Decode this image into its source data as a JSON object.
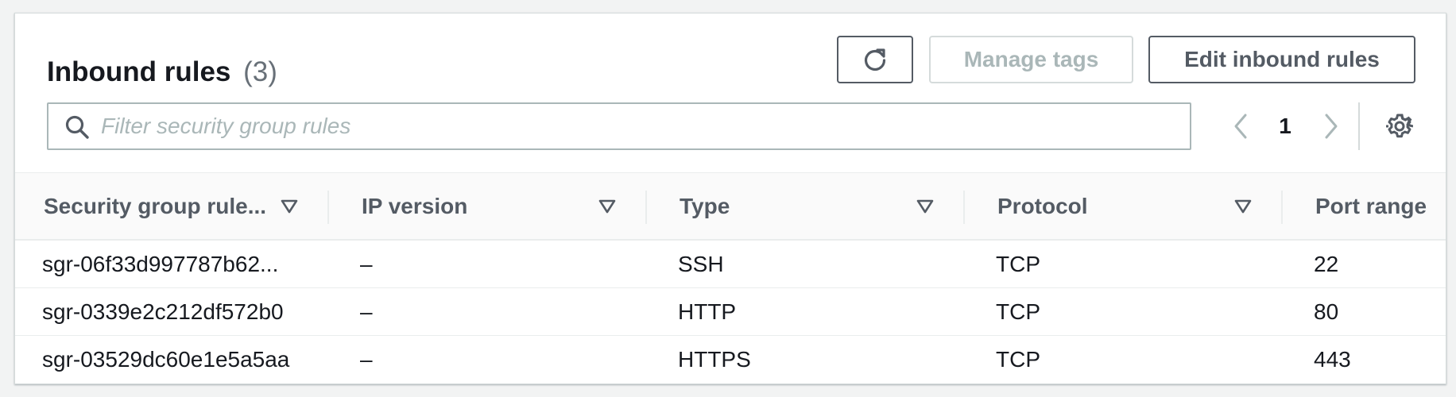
{
  "header": {
    "title": "Inbound rules",
    "count": "(3)",
    "manage_tags_label": "Manage tags",
    "edit_label": "Edit inbound rules"
  },
  "filter": {
    "placeholder": "Filter security group rules",
    "value": ""
  },
  "pagination": {
    "current_page": "1"
  },
  "table": {
    "columns": [
      "Security group rule...",
      "IP version",
      "Type",
      "Protocol",
      "Port range"
    ],
    "rows": [
      [
        "sgr-06f33d997787b62...",
        "–",
        "SSH",
        "TCP",
        "22"
      ],
      [
        "sgr-0339e2c212df572b0",
        "–",
        "HTTP",
        "TCP",
        "80"
      ],
      [
        "sgr-03529dc60e1e5a5aa",
        "–",
        "HTTPS",
        "TCP",
        "443"
      ]
    ]
  },
  "icons": {
    "refresh": "refresh-icon",
    "search": "search-icon",
    "prev": "chevron-left-icon",
    "next": "chevron-right-icon",
    "settings": "gear-icon",
    "sort": "sort-caret-down-icon"
  },
  "colors": {
    "text": "#16191f",
    "secondary_text": "#545b64",
    "disabled": "#aab7b8",
    "border": "#eaeded"
  }
}
